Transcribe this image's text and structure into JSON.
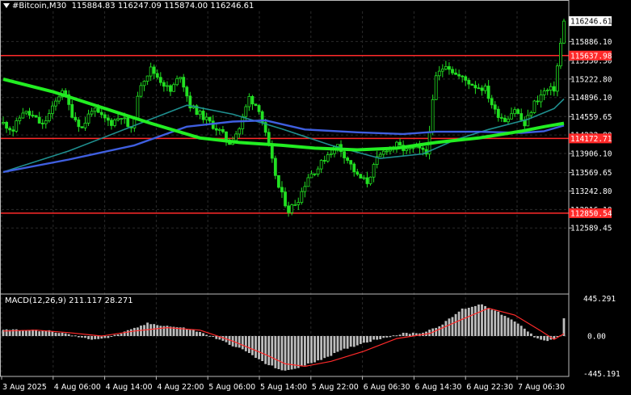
{
  "header": {
    "symbol": "#Bitcoin,M30",
    "ohlc": "115884.83 116247.09 115874.00 116246.61"
  },
  "colors": {
    "background": "#000000",
    "grid": "#2b2b2b",
    "candle": "#22e022",
    "sma_fast": "#1f8f8f",
    "sma_mid": "#3f5fe0",
    "sma_slow": "#22ee22",
    "level_line": "#ff2a2a",
    "macd_hist": "#bdbdbd",
    "macd_signal": "#ff2a2a",
    "axis_text": "#ffffff",
    "price_tag_bg": "#ff2a2a",
    "current_tag_bg": "#ffffff"
  },
  "chart_data": {
    "type": "candlestick",
    "title": "#Bitcoin,M30",
    "ylim": [
      111450,
      116420
    ],
    "x_tick_labels": [
      "3 Aug 2025",
      "4 Aug 06:00",
      "4 Aug 14:00",
      "4 Aug 22:00",
      "5 Aug 06:00",
      "5 Aug 14:00",
      "5 Aug 22:00",
      "6 Aug 06:30",
      "6 Aug 14:30",
      "6 Aug 22:30",
      "7 Aug 06:30"
    ],
    "y_tick_labels": [
      "115886.10",
      "115550.50",
      "115222.80",
      "114896.10",
      "114559.65",
      "114232.80",
      "113906.10",
      "113569.65",
      "113242.80",
      "112916.10",
      "112589.45"
    ],
    "horizontal_levels": [
      {
        "label": "115637.98",
        "value": 115637.98
      },
      {
        "label": "114172.71",
        "value": 114172.71
      },
      {
        "label": "112850.54",
        "value": 112850.54
      }
    ],
    "current_price": {
      "label": "116246.61",
      "value": 116246.61
    },
    "close_path": [
      [
        0,
        114440
      ],
      [
        3,
        114320
      ],
      [
        6,
        114650
      ],
      [
        9,
        114560
      ],
      [
        12,
        114400
      ],
      [
        15,
        114700
      ],
      [
        18,
        115050
      ],
      [
        21,
        114600
      ],
      [
        24,
        114350
      ],
      [
        27,
        114700
      ],
      [
        30,
        114550
      ],
      [
        33,
        114450
      ],
      [
        36,
        114580
      ],
      [
        39,
        114300
      ],
      [
        42,
        115150
      ],
      [
        45,
        115400
      ],
      [
        48,
        115200
      ],
      [
        51,
        115000
      ],
      [
        54,
        115300
      ],
      [
        57,
        114750
      ],
      [
        60,
        114600
      ],
      [
        63,
        114450
      ],
      [
        66,
        114300
      ],
      [
        69,
        114100
      ],
      [
        72,
        114350
      ],
      [
        75,
        114900
      ],
      [
        78,
        114700
      ],
      [
        81,
        114000
      ],
      [
        84,
        113300
      ],
      [
        87,
        112900
      ],
      [
        90,
        113100
      ],
      [
        93,
        113500
      ],
      [
        96,
        113650
      ],
      [
        99,
        113900
      ],
      [
        102,
        114050
      ],
      [
        105,
        113800
      ],
      [
        108,
        113500
      ],
      [
        111,
        113400
      ],
      [
        114,
        113800
      ],
      [
        117,
        114000
      ],
      [
        120,
        114050
      ],
      [
        123,
        113950
      ],
      [
        126,
        114000
      ],
      [
        129,
        113900
      ],
      [
        132,
        115250
      ],
      [
        135,
        115500
      ],
      [
        138,
        115300
      ],
      [
        141,
        115200
      ],
      [
        144,
        115100
      ],
      [
        147,
        115050
      ],
      [
        150,
        114650
      ],
      [
        153,
        114500
      ],
      [
        156,
        114700
      ],
      [
        159,
        114400
      ],
      [
        162,
        114800
      ],
      [
        165,
        115000
      ],
      [
        168,
        115050
      ],
      [
        171,
        116246.61
      ]
    ],
    "series": [
      {
        "name": "",
        "type": "sma_fast",
        "points": [
          [
            0,
            113580
          ],
          [
            20,
            113950
          ],
          [
            40,
            114400
          ],
          [
            56,
            114760
          ],
          [
            70,
            114600
          ],
          [
            85,
            114340
          ],
          [
            100,
            114050
          ],
          [
            115,
            113820
          ],
          [
            128,
            113900
          ],
          [
            138,
            114150
          ],
          [
            148,
            114330
          ],
          [
            160,
            114510
          ],
          [
            168,
            114700
          ],
          [
            171,
            114870
          ]
        ]
      },
      {
        "name": "",
        "type": "sma_mid",
        "points": [
          [
            0,
            113580
          ],
          [
            20,
            113800
          ],
          [
            40,
            114050
          ],
          [
            56,
            114380
          ],
          [
            70,
            114470
          ],
          [
            80,
            114490
          ],
          [
            92,
            114330
          ],
          [
            108,
            114280
          ],
          [
            122,
            114250
          ],
          [
            132,
            114290
          ],
          [
            145,
            114290
          ],
          [
            158,
            114270
          ],
          [
            165,
            114300
          ],
          [
            171,
            114400
          ]
        ]
      },
      {
        "name": "",
        "type": "sma_slow",
        "points": [
          [
            0,
            115220
          ],
          [
            15,
            115000
          ],
          [
            30,
            114720
          ],
          [
            45,
            114440
          ],
          [
            60,
            114180
          ],
          [
            72,
            114100
          ],
          [
            85,
            114050
          ],
          [
            95,
            114000
          ],
          [
            108,
            113970
          ],
          [
            120,
            114000
          ],
          [
            132,
            114100
          ],
          [
            145,
            114180
          ],
          [
            158,
            114300
          ],
          [
            165,
            114380
          ],
          [
            171,
            114440
          ]
        ]
      }
    ],
    "macd": {
      "label": "MACD(12,26,9) 211.117 28.271",
      "params": [
        12,
        26,
        9
      ],
      "main": 211.117,
      "signal": 28.271,
      "ylim": [
        -480,
        480
      ],
      "y_tick_labels": [
        "445.291",
        "0.00",
        "-445.191"
      ],
      "histogram_path": [
        [
          0,
          80
        ],
        [
          8,
          70
        ],
        [
          14,
          60
        ],
        [
          20,
          20
        ],
        [
          26,
          -40
        ],
        [
          32,
          -20
        ],
        [
          38,
          60
        ],
        [
          44,
          150
        ],
        [
          50,
          120
        ],
        [
          56,
          90
        ],
        [
          62,
          20
        ],
        [
          68,
          -80
        ],
        [
          74,
          -180
        ],
        [
          80,
          -330
        ],
        [
          86,
          -420
        ],
        [
          92,
          -350
        ],
        [
          98,
          -260
        ],
        [
          104,
          -160
        ],
        [
          110,
          -80
        ],
        [
          116,
          -20
        ],
        [
          122,
          30
        ],
        [
          128,
          40
        ],
        [
          134,
          140
        ],
        [
          140,
          320
        ],
        [
          146,
          380
        ],
        [
          152,
          260
        ],
        [
          158,
          120
        ],
        [
          162,
          -10
        ],
        [
          166,
          -60
        ],
        [
          170,
          0
        ],
        [
          171,
          211
        ]
      ],
      "signal_path": [
        [
          0,
          60
        ],
        [
          10,
          70
        ],
        [
          20,
          40
        ],
        [
          30,
          0
        ],
        [
          40,
          60
        ],
        [
          50,
          100
        ],
        [
          60,
          70
        ],
        [
          70,
          -60
        ],
        [
          80,
          -220
        ],
        [
          86,
          -330
        ],
        [
          92,
          -360
        ],
        [
          100,
          -300
        ],
        [
          110,
          -180
        ],
        [
          120,
          -30
        ],
        [
          130,
          30
        ],
        [
          140,
          200
        ],
        [
          148,
          330
        ],
        [
          156,
          250
        ],
        [
          164,
          60
        ],
        [
          168,
          -40
        ],
        [
          171,
          28
        ]
      ]
    }
  }
}
